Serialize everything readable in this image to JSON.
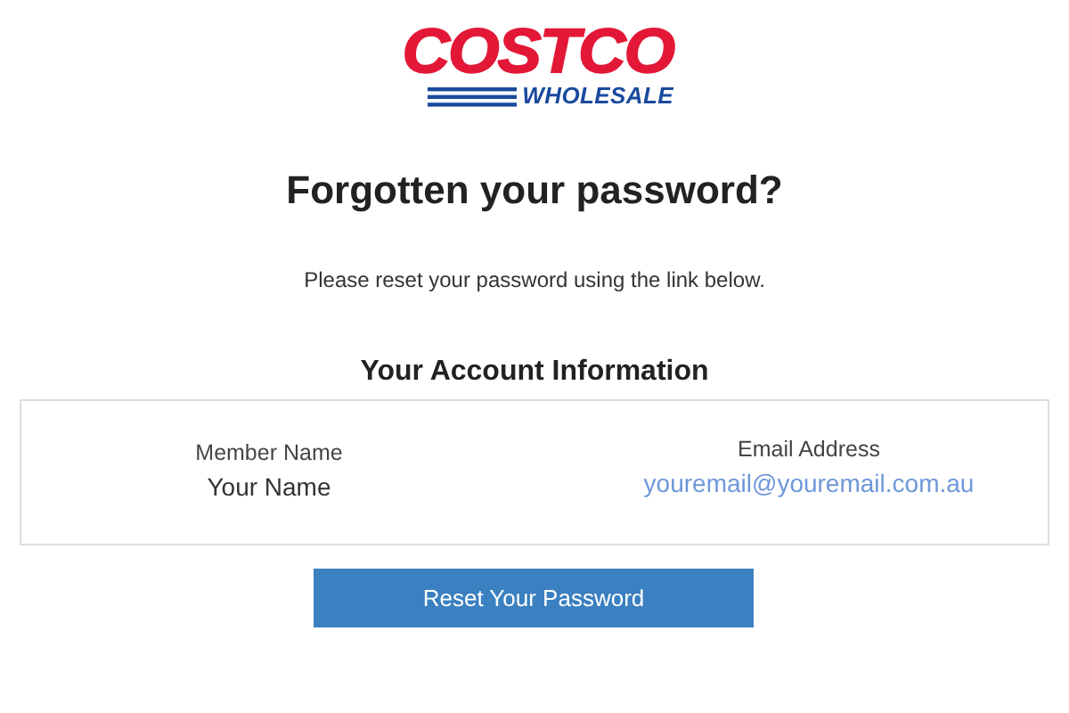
{
  "logo": {
    "brand": "COSTCO",
    "tagline": "WHOLESALE"
  },
  "title": "Forgotten your password?",
  "message": "Please reset your password using the link below.",
  "account": {
    "heading": "Your Account Information",
    "fields": [
      {
        "label": "Member Name",
        "value": "Your Name",
        "kind": "text"
      },
      {
        "label": "Email Address",
        "value": "youremail@youremail.com.au",
        "kind": "link"
      }
    ]
  },
  "button": "Reset Your Password"
}
